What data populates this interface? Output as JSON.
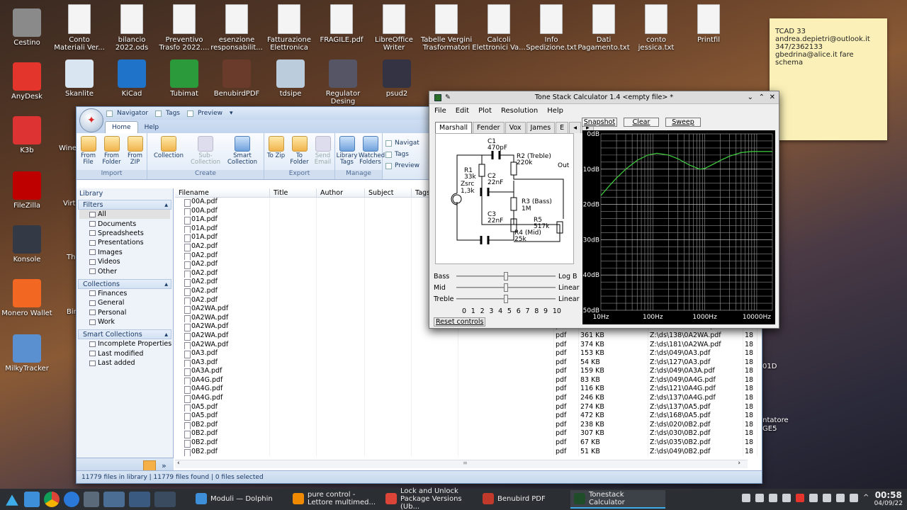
{
  "desktop": {
    "left_icons": [
      {
        "label": "Cestino",
        "icon": "trash-icon",
        "color": "#8a8a8a"
      },
      {
        "label": "AnyDesk",
        "icon": "anydesk-icon",
        "color": "#e3352c"
      },
      {
        "label": "K3b",
        "icon": "k3b-icon",
        "color": "#d33"
      },
      {
        "label": "FileZilla",
        "icon": "filezilla-icon",
        "color": "#bf0000"
      },
      {
        "label": "Konsole",
        "icon": "terminal-icon",
        "color": "#333a45"
      },
      {
        "label": "Monero Wallet",
        "icon": "monero-icon",
        "color": "#f26822"
      },
      {
        "label": "MilkyTracker",
        "icon": "milkytracker-icon",
        "color": "#5a8fd0"
      }
    ],
    "top_icons": [
      {
        "label": "Conto Materiali Ver...",
        "icon": "spreadsheet-icon"
      },
      {
        "label": "bilancio 2022.ods",
        "icon": "spreadsheet-icon"
      },
      {
        "label": "Preventivo Trasfo 2022....",
        "icon": "spreadsheet-icon"
      },
      {
        "label": "esenzione responsabilit...",
        "icon": "pdf-document-icon"
      },
      {
        "label": "Fatturazione Elettronica",
        "icon": "document-icon"
      },
      {
        "label": "FRAGILE.pdf",
        "icon": "pdf-document-icon"
      },
      {
        "label": "LibreOffice Writer",
        "icon": "writer-icon"
      },
      {
        "label": "Tabelle Vergini Trasformatori",
        "icon": "folder-icon"
      },
      {
        "label": "Calcoli Elettronici Va...",
        "icon": "spreadsheet-icon"
      },
      {
        "label": "Info Spedizione.txt",
        "icon": "text-file-icon"
      },
      {
        "label": "Dati Pagamento.txt",
        "icon": "text-file-icon"
      },
      {
        "label": "conto jessica.txt",
        "icon": "text-file-icon"
      },
      {
        "label": "Printfil",
        "icon": "printer-icon"
      }
    ],
    "second_row_icons": [
      {
        "label": "Skanlite",
        "icon": "scanner-icon"
      },
      {
        "label": "KiCad",
        "icon": "kicad-icon"
      },
      {
        "label": "Tubimat",
        "icon": "tubimat-icon"
      },
      {
        "label": "BenubirdPDF",
        "icon": "benubird-icon"
      },
      {
        "label": "tdsipe",
        "icon": "tube-icon"
      },
      {
        "label": "Regulator Desing",
        "icon": "regulator-icon"
      },
      {
        "label": "psud2",
        "icon": "calculator-icon"
      }
    ],
    "partial_labels": [
      "Wine",
      "Virtu",
      "The",
      "Bin",
      "01D",
      "entatore",
      "GE5",
      ".6"
    ]
  },
  "sticky_note": {
    "lines": [
      "TCAD 33",
      "andrea.depietri@outlook.it",
      "347/2362133",
      "gbedrina@alice.it fare schema"
    ]
  },
  "library": {
    "title_items": [
      "Navigator",
      "Tags",
      "Preview"
    ],
    "ribbon_tabs": [
      "Home",
      "Help"
    ],
    "groups": [
      {
        "label": "Import",
        "buttons": [
          {
            "label": "From File",
            "enabled": true
          },
          {
            "label": "From Folder",
            "enabled": true
          },
          {
            "label": "From ZIP",
            "enabled": true
          }
        ]
      },
      {
        "label": "Create",
        "buttons": [
          {
            "label": "Collection",
            "enabled": true
          },
          {
            "label": "Sub-Collection",
            "enabled": false
          },
          {
            "label": "Smart Collection",
            "enabled": true
          }
        ]
      },
      {
        "label": "Export",
        "buttons": [
          {
            "label": "To Zip",
            "enabled": true
          },
          {
            "label": "To Folder",
            "enabled": true
          },
          {
            "label": "Send Email",
            "enabled": false
          }
        ]
      },
      {
        "label": "Manage",
        "buttons": [
          {
            "label": "Library Tags",
            "enabled": true
          },
          {
            "label": "Watched Folders",
            "enabled": true
          }
        ]
      }
    ],
    "view_checks": [
      "Navigat",
      "Tags",
      "Preview"
    ],
    "sidebar": {
      "title": "Library",
      "filters_header": "Filters",
      "filters": [
        "All",
        "Documents",
        "Spreadsheets",
        "Presentations",
        "Images",
        "Videos",
        "Other"
      ],
      "collections_header": "Collections",
      "collections": [
        "Finances",
        "General",
        "Personal",
        "Work"
      ],
      "smart_header": "Smart Collections",
      "smart": [
        "Incomplete Properties",
        "Last modified",
        "Last added"
      ]
    },
    "columns": [
      "Filename",
      "Title",
      "Author",
      "Subject",
      "Tags"
    ],
    "rows": [
      {
        "f": "00A.pdf",
        "t": "",
        "s": "",
        "p": "",
        "n": ""
      },
      {
        "f": "00A.pdf",
        "t": "",
        "s": "",
        "p": "",
        "n": ""
      },
      {
        "f": "01A.pdf",
        "t": "",
        "s": "",
        "p": "",
        "n": ""
      },
      {
        "f": "01A.pdf",
        "t": "",
        "s": "",
        "p": "",
        "n": ""
      },
      {
        "f": "01A.pdf",
        "t": "",
        "s": "",
        "p": "",
        "n": ""
      },
      {
        "f": "0A2.pdf",
        "t": "",
        "s": "",
        "p": "",
        "n": ""
      },
      {
        "f": "0A2.pdf",
        "t": "",
        "s": "",
        "p": "",
        "n": ""
      },
      {
        "f": "0A2.pdf",
        "t": "",
        "s": "",
        "p": "",
        "n": ""
      },
      {
        "f": "0A2.pdf",
        "t": "",
        "s": "",
        "p": "",
        "n": ""
      },
      {
        "f": "0A2.pdf",
        "t": "",
        "s": "",
        "p": "",
        "n": ""
      },
      {
        "f": "0A2.pdf",
        "t": "",
        "s": "",
        "p": "",
        "n": ""
      },
      {
        "f": "0A2.pdf",
        "t": "",
        "s": "",
        "p": "",
        "n": ""
      },
      {
        "f": "0A2WA.pdf",
        "t": "",
        "s": "",
        "p": "",
        "n": ""
      },
      {
        "f": "0A2WA.pdf",
        "t": "",
        "s": "",
        "p": "",
        "n": ""
      },
      {
        "f": "0A2WA.pdf",
        "t": "pdf",
        "s": "",
        "p": "Z:\\ds\\007\\0A2WA.pdf",
        "n": "18"
      },
      {
        "f": "0A2WA.pdf",
        "t": "pdf",
        "s": "361 KB",
        "p": "Z:\\ds\\138\\0A2WA.pdf",
        "n": "18"
      },
      {
        "f": "0A2WA.pdf",
        "t": "pdf",
        "s": "374 KB",
        "p": "Z:\\ds\\181\\0A2WA.pdf",
        "n": "18"
      },
      {
        "f": "0A3.pdf",
        "t": "pdf",
        "s": "153 KB",
        "p": "Z:\\ds\\049\\0A3.pdf",
        "n": "18"
      },
      {
        "f": "0A3.pdf",
        "t": "pdf",
        "s": "54 KB",
        "p": "Z:\\ds\\127\\0A3.pdf",
        "n": "18"
      },
      {
        "f": "0A3A.pdf",
        "t": "pdf",
        "s": "159 KB",
        "p": "Z:\\ds\\049\\0A3A.pdf",
        "n": "18"
      },
      {
        "f": "0A4G.pdf",
        "t": "pdf",
        "s": "83 KB",
        "p": "Z:\\ds\\049\\0A4G.pdf",
        "n": "18"
      },
      {
        "f": "0A4G.pdf",
        "t": "pdf",
        "s": "116 KB",
        "p": "Z:\\ds\\121\\0A4G.pdf",
        "n": "18"
      },
      {
        "f": "0A4G.pdf",
        "t": "pdf",
        "s": "246 KB",
        "p": "Z:\\ds\\137\\0A4G.pdf",
        "n": "18"
      },
      {
        "f": "0A5.pdf",
        "t": "pdf",
        "s": "274 KB",
        "p": "Z:\\ds\\137\\0A5.pdf",
        "n": "18"
      },
      {
        "f": "0A5.pdf",
        "t": "pdf",
        "s": "472 KB",
        "p": "Z:\\ds\\168\\0A5.pdf",
        "n": "18"
      },
      {
        "f": "0B2.pdf",
        "t": "pdf",
        "s": "238 KB",
        "p": "Z:\\ds\\020\\0B2.pdf",
        "n": "18"
      },
      {
        "f": "0B2.pdf",
        "t": "pdf",
        "s": "307 KB",
        "p": "Z:\\ds\\030\\0B2.pdf",
        "n": "18"
      },
      {
        "f": "0B2.pdf",
        "t": "pdf",
        "s": "67 KB",
        "p": "Z:\\ds\\035\\0B2.pdf",
        "n": "18"
      },
      {
        "f": "0B2.pdf",
        "t": "pdf",
        "s": "51 KB",
        "p": "Z:\\ds\\049\\0B2.pdf",
        "n": "18"
      }
    ],
    "status": "11779 files in library | 11779 files found | 0 files selected"
  },
  "tonestack": {
    "title": "Tone Stack Calculator 1.4 <empty file> *",
    "menu": [
      "File",
      "Edit",
      "Plot",
      "Resolution",
      "Help"
    ],
    "tabs": [
      "Marshall",
      "Fender",
      "Vox",
      "James",
      "E s"
    ],
    "buttons": {
      "snapshot": "Snapshot",
      "clear": "Clear",
      "sweep": "Sweep",
      "reset": "Reset controls"
    },
    "components": {
      "c1": "C1",
      "c1v": "470pF",
      "r2": "R2 (Treble)",
      "r2v": "220k",
      "out": "Out",
      "r1": "R1",
      "r1v": "33k",
      "c2": "C2",
      "c2v": "22nF",
      "zsrc": "Zsrc",
      "zsrcv": "1,3k",
      "r3": "R3 (Bass)",
      "r3v": "1M",
      "r5": "R5",
      "r5v": "517k",
      "c3": "C3",
      "c3v": "22nF",
      "r4": "R4 (Mid)",
      "r4v": "25k"
    },
    "sliders": [
      {
        "label": "Bass",
        "mode": "Log B",
        "value": 5
      },
      {
        "label": "Mid",
        "mode": "Linear",
        "value": 5
      },
      {
        "label": "Treble",
        "mode": "Linear",
        "value": 5
      }
    ],
    "ticks": [
      "0",
      "1",
      "2",
      "3",
      "4",
      "5",
      "6",
      "7",
      "8",
      "9",
      "10"
    ]
  },
  "chart_data": {
    "type": "line",
    "y_ticks": [
      "0dB",
      "-10dB",
      "-20dB",
      "-30dB",
      "-40dB",
      "-50dB"
    ],
    "x_ticks": [
      "10Hz",
      "100Hz",
      "1000Hz",
      "10000Hz"
    ],
    "xlim": [
      10,
      20000
    ],
    "ylim": [
      -50,
      0
    ],
    "xscale": "log",
    "grid": true,
    "line_color": "#3fcf3f",
    "series": [
      {
        "x": [
          10,
          15,
          20,
          30,
          50,
          80,
          120,
          200,
          300,
          500,
          800,
          1000,
          1500,
          2000,
          3000,
          5000,
          8000,
          10000,
          20000
        ],
        "y": [
          -17.5,
          -14.5,
          -12.5,
          -10,
          -7.5,
          -6,
          -5.5,
          -6,
          -7,
          -8.8,
          -10,
          -9.8,
          -8.5,
          -7.5,
          -6.3,
          -5.3,
          -5,
          -5,
          -5
        ]
      }
    ]
  },
  "taskbar": {
    "tasks": [
      {
        "label": "Moduli — Dolphin",
        "icon": "folder-icon",
        "active": false
      },
      {
        "label": "pure control - Lettore multimed...",
        "icon": "vlc-icon",
        "active": false
      },
      {
        "label": "Lock and Unlock Package Versions (Ub...",
        "icon": "chrome-icon",
        "active": false
      },
      {
        "label": "Benubird PDF",
        "icon": "benubird-icon",
        "active": false
      },
      {
        "label": "Tonestack Calculator",
        "icon": "tonestack-icon",
        "active": true
      }
    ],
    "time": "00:58",
    "date": "04/09/22"
  }
}
